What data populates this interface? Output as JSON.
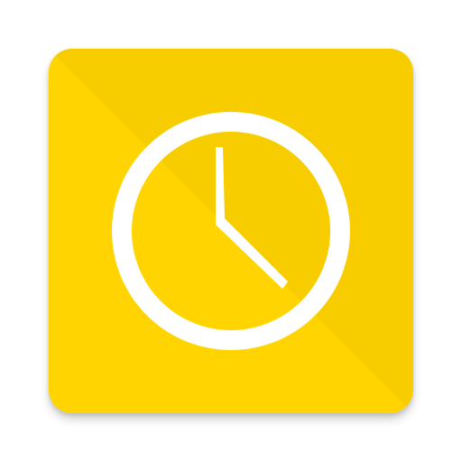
{
  "app_icon": {
    "icon": "clock-icon",
    "background_color": "#FFD400",
    "glyph_color": "#FFFFFF"
  }
}
